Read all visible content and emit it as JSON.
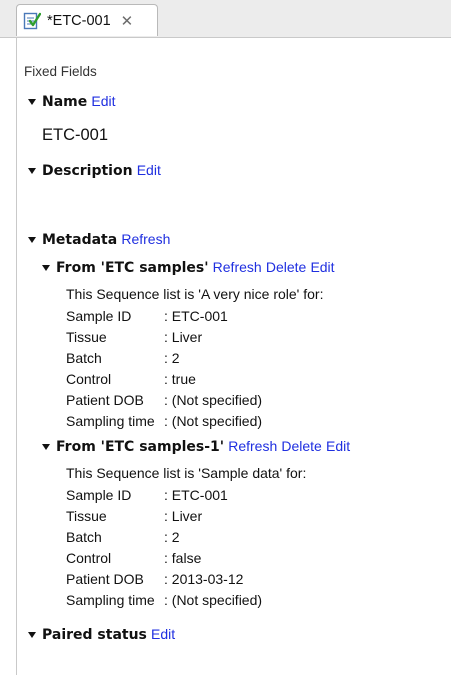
{
  "tab": {
    "title": "*ETC-001",
    "close_glyph": "✕",
    "icon": "sequence-list-icon"
  },
  "fixed_fields_label": "Fixed Fields",
  "name_section": {
    "title": "Name",
    "edit_label": "Edit",
    "value": "ETC-001"
  },
  "description_section": {
    "title": "Description",
    "edit_label": "Edit"
  },
  "metadata_section": {
    "title": "Metadata",
    "refresh_label": "Refresh",
    "groups": [
      {
        "title": "From 'ETC samples'",
        "refresh_label": "Refresh",
        "delete_label": "Delete",
        "edit_label": "Edit",
        "intro": "This Sequence list is 'A very nice role' for:",
        "rows": [
          {
            "key": "Sample ID",
            "value": ": ETC-001"
          },
          {
            "key": "Tissue",
            "value": ": Liver"
          },
          {
            "key": "Batch",
            "value": ": 2"
          },
          {
            "key": "Control",
            "value": ": true"
          },
          {
            "key": "Patient DOB",
            "value": ": (Not specified)"
          },
          {
            "key": "Sampling time",
            "value": ": (Not specified)"
          }
        ]
      },
      {
        "title": "From 'ETC samples-1'",
        "refresh_label": "Refresh",
        "delete_label": "Delete",
        "edit_label": "Edit",
        "intro": "This Sequence list is 'Sample data' for:",
        "rows": [
          {
            "key": "Sample ID",
            "value": ": ETC-001"
          },
          {
            "key": "Tissue",
            "value": ": Liver"
          },
          {
            "key": "Batch",
            "value": ": 2"
          },
          {
            "key": "Control",
            "value": ": false"
          },
          {
            "key": "Patient DOB",
            "value": ": 2013-03-12"
          },
          {
            "key": "Sampling time",
            "value": ": (Not specified)"
          }
        ]
      }
    ]
  },
  "paired_status_section": {
    "title": "Paired status",
    "edit_label": "Edit"
  },
  "colors": {
    "link": "#1f2fe0",
    "text": "#111111",
    "tab_bar": "#ececec"
  }
}
